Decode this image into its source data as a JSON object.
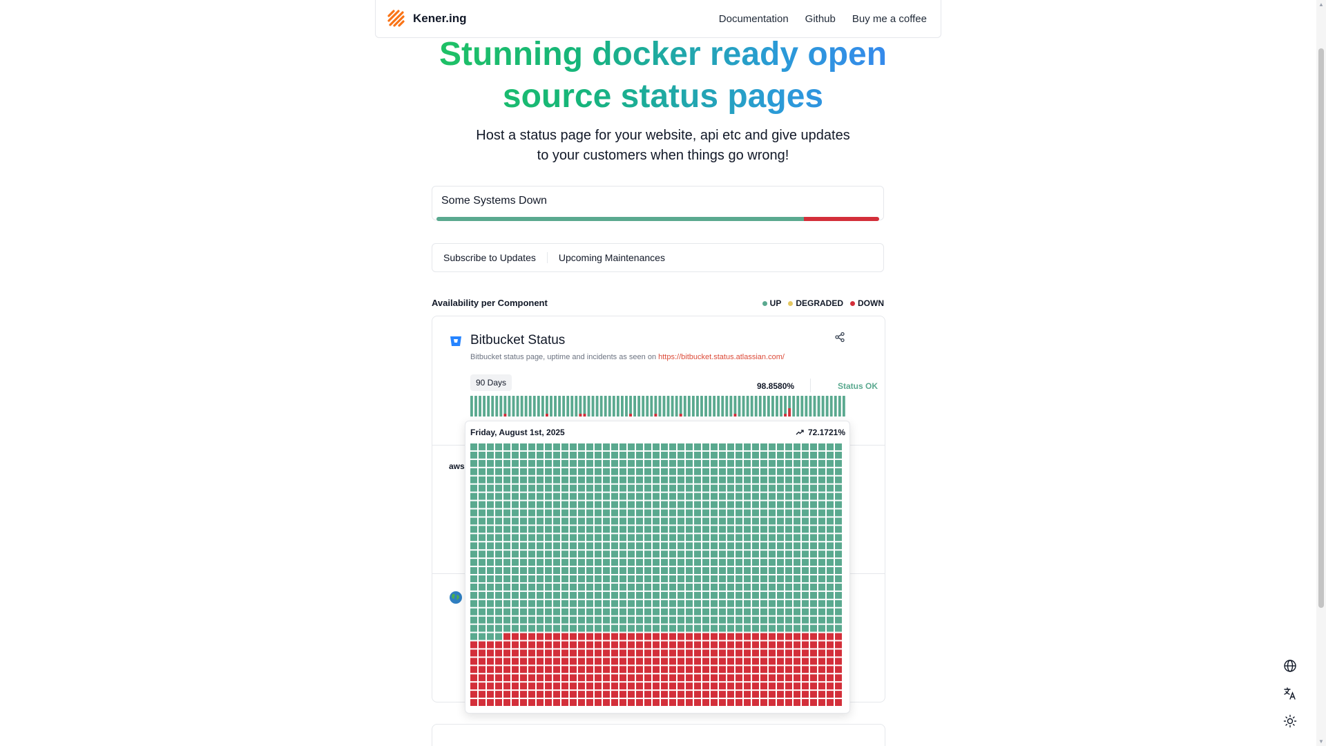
{
  "nav": {
    "brand": "Kener.ing",
    "links": [
      "Documentation",
      "Github",
      "Buy me a coffee"
    ]
  },
  "hero": {
    "title": "Stunning docker ready open source status pages",
    "subtitle_line1": "Host a status page for your website, api etc and give updates",
    "subtitle_line2": "to your customers when things go wrong!"
  },
  "status": {
    "text": "Some Systems Down",
    "up_fraction": 0.83,
    "down_fraction": 0.17
  },
  "tabs": [
    "Subscribe to Updates",
    "Upcoming Maintenances"
  ],
  "section": {
    "title": "Availability per Component",
    "legend": [
      {
        "label": "UP",
        "color": "#5aa98f"
      },
      {
        "label": "DEGRADED",
        "color": "#e5c862"
      },
      {
        "label": "DOWN",
        "color": "#d32f3a"
      }
    ]
  },
  "monitor": {
    "title": "Bitbucket Status",
    "description": "Bitbucket status page, uptime and incidents as seen on ",
    "link": "https://bitbucket.status.atlassian.com/",
    "days_label": "90 Days",
    "uptime": "98.8580%",
    "status": "Status OK",
    "aws_label": "aws"
  },
  "popover": {
    "date": "Friday, August 1st, 2025",
    "percent": "72.1721%",
    "total_minutes": 1440,
    "up_minutes": 1039,
    "down_minutes": 401
  },
  "colors": {
    "up": "#5aa98f",
    "down": "#d32f3a",
    "degraded": "#e5c862"
  }
}
